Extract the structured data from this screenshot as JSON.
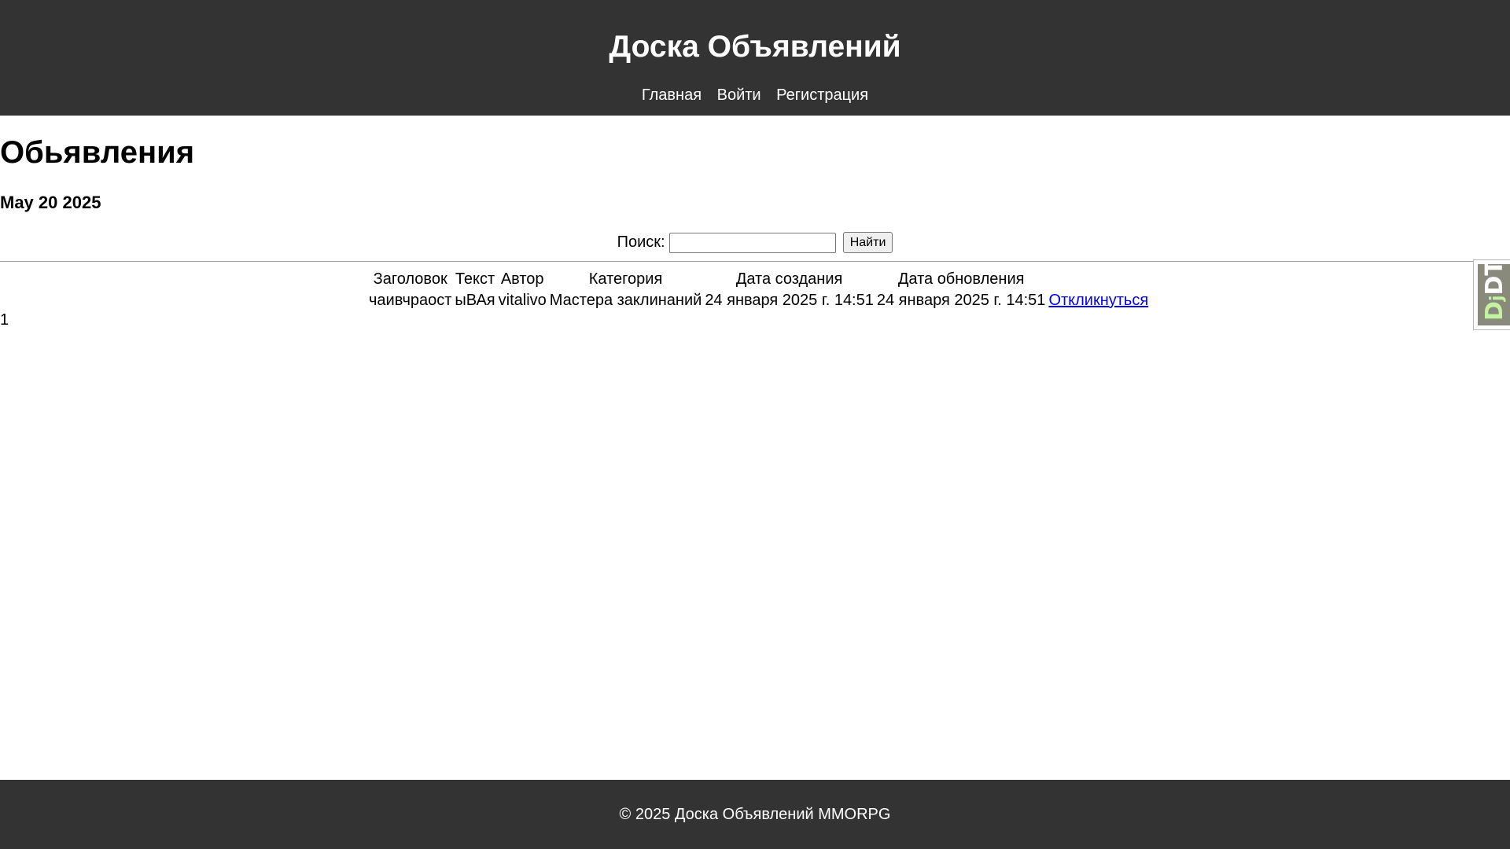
{
  "header": {
    "title": "Доска Объявлений",
    "nav": [
      "Главная",
      "Войти",
      "Регистрация"
    ]
  },
  "main": {
    "title": "Обьявления",
    "date": "May 20 2025",
    "search": {
      "label": "Поиск:",
      "value": "",
      "button": "Найти"
    },
    "table": {
      "columns": [
        "Заголовок",
        "Текст",
        "Автор",
        "Категория",
        "Дата создания",
        "Дата обновления"
      ],
      "rows": [
        {
          "title": "чаивчраост",
          "text": "ыВАя",
          "author": "vitalivo",
          "category": "Мастера заклинаний",
          "created": "24 января 2025 г. 14:51",
          "updated": "24 января 2025 г. 14:51",
          "action": "Откликнуться"
        }
      ]
    },
    "pagination": "1"
  },
  "debug_toolbar": {
    "label": "DjDT"
  },
  "footer": {
    "text": "© 2025 Доска Объявлений MMORPG"
  },
  "colors": {
    "header_bg": "#333333",
    "link": "#0000ee",
    "toolbar_accent": "#c3f2a0"
  }
}
